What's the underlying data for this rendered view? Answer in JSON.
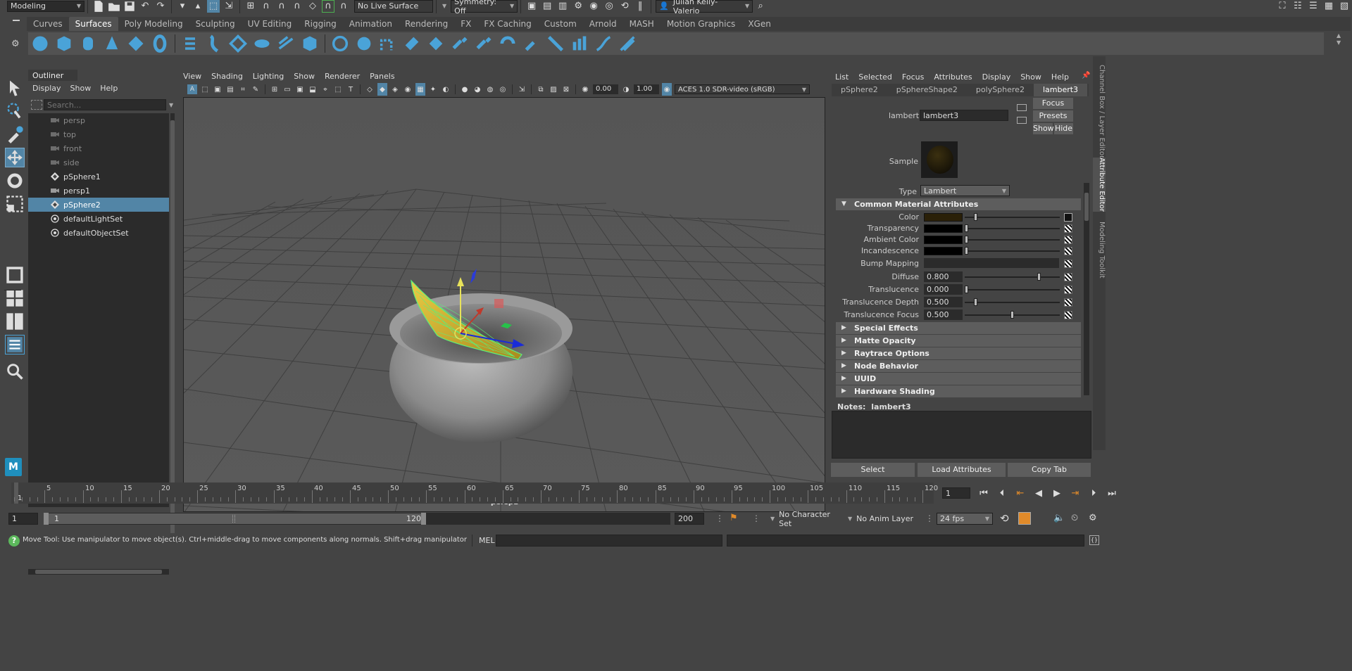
{
  "status_line": {
    "menu_set": "Modeling",
    "live_surface": "No Live Surface",
    "symmetry": "Symmetry: Off",
    "user": "Julian Kelly-Valerio"
  },
  "shelf": {
    "tabs": [
      "Curves",
      "Surfaces",
      "Poly Modeling",
      "Sculpting",
      "UV Editing",
      "Rigging",
      "Animation",
      "Rendering",
      "FX",
      "FX Caching",
      "Custom",
      "Arnold",
      "MASH",
      "Motion Graphics",
      "XGen"
    ],
    "active_tab": "Surfaces"
  },
  "outliner": {
    "title": "Outliner",
    "menu": [
      "Display",
      "Show",
      "Help"
    ],
    "search_placeholder": "Search...",
    "items": [
      {
        "label": "persp",
        "icon": "camera-icon",
        "dim": true
      },
      {
        "label": "top",
        "icon": "camera-icon",
        "dim": true
      },
      {
        "label": "front",
        "icon": "camera-icon",
        "dim": true
      },
      {
        "label": "side",
        "icon": "camera-icon",
        "dim": true
      },
      {
        "label": "pSphere1",
        "icon": "mesh-icon",
        "dim": false
      },
      {
        "label": "persp1",
        "icon": "camera-icon",
        "dim": false
      },
      {
        "label": "pSphere2",
        "icon": "mesh-icon",
        "dim": false,
        "selected": true
      },
      {
        "label": "defaultLightSet",
        "icon": "set-icon",
        "dim": false
      },
      {
        "label": "defaultObjectSet",
        "icon": "set-icon",
        "dim": false
      }
    ]
  },
  "viewport": {
    "menu": [
      "View",
      "Shading",
      "Lighting",
      "Show",
      "Renderer",
      "Panels"
    ],
    "exposure": "0.00",
    "gamma": "1.00",
    "color_space": "ACES 1.0 SDR-video (sRGB)",
    "camera_label": "persp1"
  },
  "attribute_editor": {
    "menu": [
      "List",
      "Selected",
      "Focus",
      "Attributes",
      "Display",
      "Show",
      "Help"
    ],
    "node_tabs": [
      "pSphere2",
      "pSphereShape2",
      "polySphere2",
      "lambert3"
    ],
    "active_tab": "lambert3",
    "node_label": "lambert:",
    "node_name": "lambert3",
    "focus_btn": "Focus",
    "presets_btn": "Presets",
    "show_btn": "Show",
    "hide_btn": "Hide",
    "sample_label": "Sample",
    "type_label": "Type",
    "type_value": "Lambert",
    "common_section": "Common Material Attributes",
    "attrs": [
      {
        "label": "Color",
        "kind": "color",
        "color": "#2a2008",
        "level": 0.1
      },
      {
        "label": "Transparency",
        "kind": "color",
        "color": "#000000",
        "level": 0.0
      },
      {
        "label": "Ambient Color",
        "kind": "color",
        "color": "#000000",
        "level": 0.0
      },
      {
        "label": "Incandescence",
        "kind": "color",
        "color": "#000000",
        "level": 0.0
      },
      {
        "label": "Bump Mapping",
        "kind": "map"
      },
      {
        "label": "Diffuse",
        "kind": "number",
        "value": "0.800",
        "level": 0.8
      },
      {
        "label": "Translucence",
        "kind": "number",
        "value": "0.000",
        "level": 0.0
      },
      {
        "label": "Translucence Depth",
        "kind": "number",
        "value": "0.500",
        "level": 0.1
      },
      {
        "label": "Translucence Focus",
        "kind": "number",
        "value": "0.500",
        "level": 0.5
      }
    ],
    "sections": [
      "Special Effects",
      "Matte Opacity",
      "Raytrace Options",
      "Node Behavior",
      "UUID",
      "Hardware Shading"
    ],
    "notes_label": "Notes:",
    "notes_value": "lambert3",
    "select_btn": "Select",
    "load_btn": "Load Attributes",
    "copy_btn": "Copy Tab",
    "side_tabs": [
      "Channel Box / Layer Editor",
      "Attribute Editor",
      "Modeling Toolkit"
    ]
  },
  "timeline": {
    "ticks": [
      "5",
      "10",
      "15",
      "20",
      "25",
      "30",
      "35",
      "40",
      "45",
      "50",
      "55",
      "60",
      "65",
      "70",
      "75",
      "80",
      "85",
      "90",
      "95",
      "100",
      "105",
      "110",
      "115",
      "120"
    ],
    "first_frame": "1",
    "current_frame": "1"
  },
  "range": {
    "start": "1",
    "inner_start": "1",
    "inner_end": "120",
    "end": "200",
    "character_set": "No Character Set",
    "anim_layer": "No Anim Layer",
    "fps": "24 fps"
  },
  "help_line": {
    "text": "Move Tool: Use manipulator to move object(s). Ctrl+middle-drag to move components along normals. Shift+drag manipulator axis or plane handles to extrude components or c",
    "mel_label": "MEL"
  },
  "colors": {
    "selection": "#5285a6",
    "panel": "#444444",
    "dark": "#2b2b2b",
    "highlight_yellow": "#c9a81e"
  }
}
